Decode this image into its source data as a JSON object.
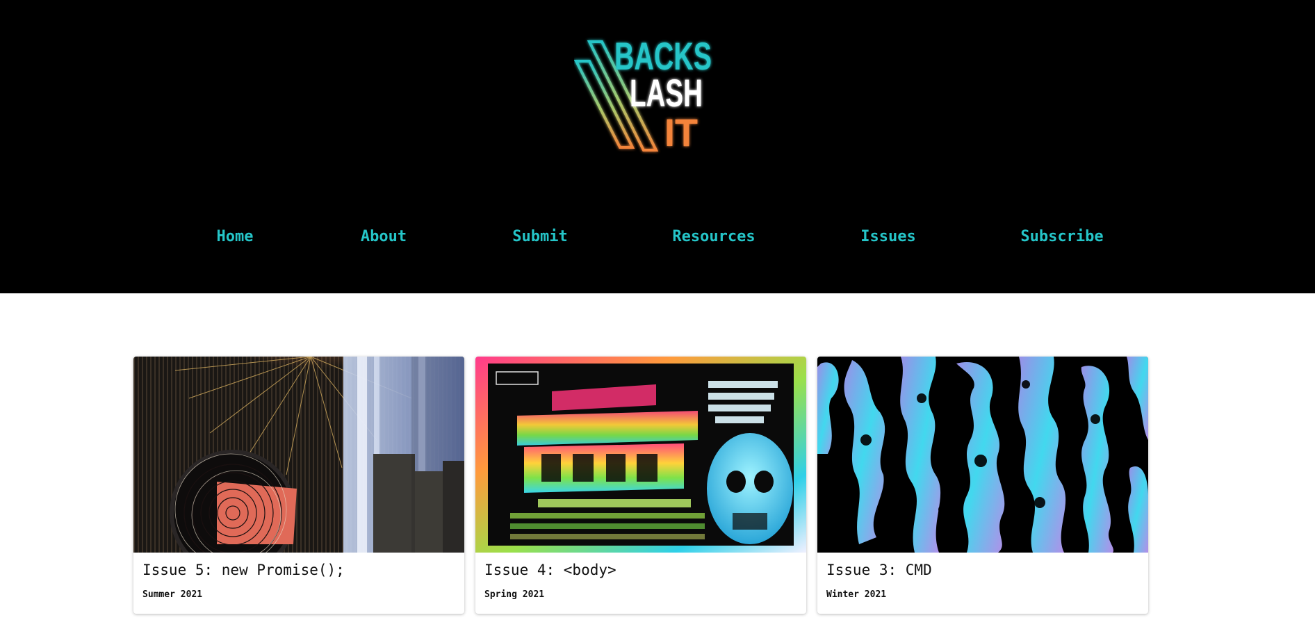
{
  "brand": {
    "logo_lines": [
      "BACKS",
      "LASH",
      "IT"
    ],
    "colors": {
      "background": "#000000",
      "accent_teal": "#25c5c8",
      "accent_orange": "#f4843a",
      "text_white": "#ffffff"
    }
  },
  "nav": {
    "items": [
      {
        "label": "Home"
      },
      {
        "label": "About"
      },
      {
        "label": "Submit"
      },
      {
        "label": "Resources"
      },
      {
        "label": "Issues"
      },
      {
        "label": "Subscribe"
      }
    ]
  },
  "issues": [
    {
      "title": "Issue 5: new Promise();",
      "date": "Summer 2021",
      "art": "glitch-spiral-cityscape"
    },
    {
      "title": "Issue 4: <body>",
      "date": "Spring 2021",
      "art": "squishy-human-body-rainbow-poster"
    },
    {
      "title": "Issue 3: CMD",
      "date": "Winter 2021",
      "art": "cyan-purple-noise-pattern"
    }
  ]
}
